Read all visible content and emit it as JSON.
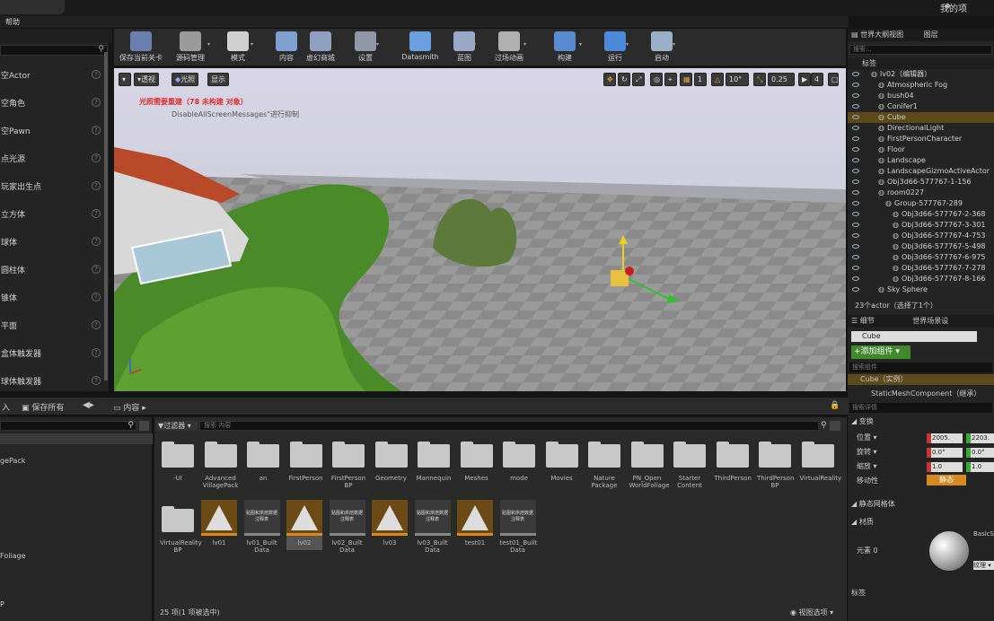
{
  "window": {
    "project": "我的项",
    "help_menu": "帮助"
  },
  "place_panel": {
    "items": [
      "空Actor",
      "空角色",
      "空Pawn",
      "点光源",
      "玩家出生点",
      "立方体",
      "球体",
      "圆柱体",
      "锥体",
      "平面",
      "盒体触发器",
      "球体触发器"
    ]
  },
  "toolbar": {
    "buttons": [
      "保存当前关卡",
      "源码管理",
      "模式",
      "内容",
      "虚幻商城",
      "设置",
      "Datasmith",
      "蓝图",
      "过场动画",
      "构建",
      "运行",
      "启动"
    ]
  },
  "viewport": {
    "perspective": "透视",
    "lit": "光照",
    "show": "显示",
    "warning": "光照需要重建（78 未构建 对象）",
    "warning_sub": "DisableAllScreenMessages\"进行抑制",
    "grid_snap": "10",
    "rot_snap": "10°",
    "scale_snap": "0.25",
    "cam_speed": "4",
    "layer_num": "1"
  },
  "outliner": {
    "tab": "世界大纲视图",
    "tab2": "图层",
    "search_placeholder": "搜索...",
    "col_label": "标签",
    "items": [
      {
        "name": "lv02（编辑器）",
        "indent": 0
      },
      {
        "name": "Atmospheric Fog",
        "indent": 1
      },
      {
        "name": "bush04",
        "indent": 1
      },
      {
        "name": "Conifer1",
        "indent": 1
      },
      {
        "name": "Cube",
        "indent": 1,
        "selected": true
      },
      {
        "name": "DirectionalLight",
        "indent": 1
      },
      {
        "name": "FirstPersonCharacter",
        "indent": 1
      },
      {
        "name": "Floor",
        "indent": 1
      },
      {
        "name": "Landscape",
        "indent": 1
      },
      {
        "name": "LandscapeGizmoActiveActor",
        "indent": 1
      },
      {
        "name": "Obj3d66-577767-1-156",
        "indent": 1
      },
      {
        "name": "room0227",
        "indent": 1
      },
      {
        "name": "Group-577767-289",
        "indent": 2
      },
      {
        "name": "Obj3d66-577767-2-368",
        "indent": 3
      },
      {
        "name": "Obj3d66-577767-3-301",
        "indent": 3
      },
      {
        "name": "Obj3d66-577767-4-753",
        "indent": 3
      },
      {
        "name": "Obj3d66-577767-5-498",
        "indent": 3
      },
      {
        "name": "Obj3d66-577767-6-975",
        "indent": 3
      },
      {
        "name": "Obj3d66-577767-7-278",
        "indent": 3
      },
      {
        "name": "Obj3d66-577767-8-166",
        "indent": 3
      },
      {
        "name": "Sky Sphere",
        "indent": 1
      }
    ],
    "count": "23个actor（选择了1个）"
  },
  "details": {
    "tab": "细节",
    "tab2": "世界场景设",
    "name": "Cube",
    "add_component": "+添加组件 ▾",
    "search_comp": "搜索组件",
    "instance": "Cube（实例）",
    "component": "StaticMeshComponent（继承）",
    "search_details": "搜索详情",
    "transform": "变换",
    "loc": "位置 ▾",
    "rot": "旋转 ▾",
    "scale": "缩放 ▾",
    "mobility": "移动性",
    "static": "静态",
    "loc_x": "2005.",
    "loc_y": "2203.",
    "rot_x": "0.0°",
    "rot_y": "0.0°",
    "scale_x": "1.0",
    "scale_y": "1.0",
    "static_mesh": "静态网格体",
    "materials": "材质",
    "element0": "元素 0",
    "mat_name": "BasicS",
    "texture": "纹理 ▾",
    "bottom": "标签"
  },
  "content_browser": {
    "import": "入",
    "save_all": "保存所有",
    "path": "内容",
    "filter": "过滤器 ▾",
    "search_placeholder": "搜索 内容",
    "left_items": [
      "gePack",
      "Foliage",
      "P"
    ],
    "folders": [
      "-UI",
      "Advanced VillagePack",
      "an",
      "FirstPerson",
      "FirstPerson BP",
      "Geometry",
      "Mannequin",
      "Meshes",
      "mode",
      "Movies",
      "Nature Package",
      "PN_Open WorldFoliage",
      "Starter Content",
      "ThirdPerson",
      "ThirdPerson BP",
      "VirtualReality"
    ],
    "folder2": "VirtualReality BP",
    "assets": [
      {
        "name": "lv01",
        "type": "level"
      },
      {
        "name": "lv01_Built Data",
        "type": "data"
      },
      {
        "name": "lv02",
        "type": "level",
        "selected": true
      },
      {
        "name": "lv02_Built Data",
        "type": "data"
      },
      {
        "name": "lv03",
        "type": "level"
      },
      {
        "name": "lv03_Built Data",
        "type": "data"
      },
      {
        "name": "test01",
        "type": "level"
      },
      {
        "name": "test01_Built Data",
        "type": "data"
      }
    ],
    "data_thumb_text": "贴图和烘焙数据注释表",
    "status": "25 项(1 项被选中)",
    "view_options": "视图选项 ▾"
  }
}
